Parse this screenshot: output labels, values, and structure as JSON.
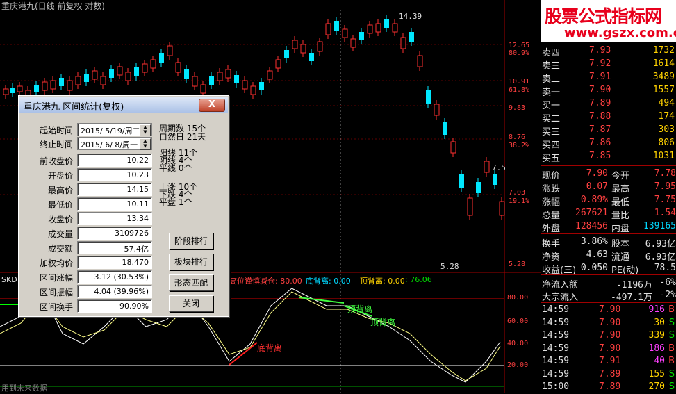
{
  "title": "重庆港九(日线 前复权 对数)",
  "price_labels": {
    "high": "14.39",
    "mid": "7.5",
    "low": "5.28"
  },
  "axis_right": {
    "t1": "12.65",
    "p1": "80.9%",
    "t2": "10.91",
    "p2": "61.8%",
    "t3": "9.83",
    "t4": "8.76",
    "p4": "38.2%",
    "t5": "7.03",
    "p5": "19.1%",
    "t6": "5.28",
    "i1": "80.00",
    "i2": "60.00",
    "i3": "40.00",
    "i4": "20.00"
  },
  "indicator": {
    "name": "SKD",
    "caption": "高位谨慎减仓: 80.00",
    "dbl_label": "底背离: 0.00",
    "tbl_label": "顶背离: 0.00",
    "val": ": 76.06",
    "ann_bottom": "底背离",
    "ann_top1": "顶背离",
    "ann_top2": "顶背离",
    "footer": "用到未来数据"
  },
  "banner": {
    "line1": "股票公式指标网",
    "line2": "www.gszx.com.cn"
  },
  "order_book": [
    {
      "label": "卖四",
      "price": "7.93",
      "vol": "1732"
    },
    {
      "label": "卖三",
      "price": "7.92",
      "vol": "1614"
    },
    {
      "label": "卖二",
      "price": "7.91",
      "vol": "3489"
    },
    {
      "label": "卖一",
      "price": "7.90",
      "vol": "1557"
    },
    {
      "label": "买一",
      "price": "7.89",
      "vol": "494"
    },
    {
      "label": "买二",
      "price": "7.88",
      "vol": "174"
    },
    {
      "label": "买三",
      "price": "7.87",
      "vol": "303"
    },
    {
      "label": "买四",
      "price": "7.86",
      "vol": "806"
    },
    {
      "label": "买五",
      "price": "7.85",
      "vol": "1031"
    }
  ],
  "quote": [
    {
      "l1": "现价",
      "v1": "7.90",
      "l2": "今开",
      "v2": "7.78"
    },
    {
      "l1": "涨跌",
      "v1": "0.07",
      "l2": "最高",
      "v2": "7.95"
    },
    {
      "l1": "涨幅",
      "v1": "0.89%",
      "l2": "最低",
      "v2": "7.75"
    },
    {
      "l1": "总量",
      "v1": "267621",
      "l2": "量比",
      "v2": "1.54"
    },
    {
      "l1": "外盘",
      "v1": "128456",
      "l2": "内盘",
      "v2": "139165"
    },
    {
      "l1": "换手",
      "v1": "3.86%",
      "l2": "股本",
      "v2": "6.93亿"
    },
    {
      "l1": "净资",
      "v1": "4.63",
      "l2": "流通",
      "v2": "6.93亿"
    },
    {
      "l1": "收益(三)",
      "v1": "0.050",
      "l2": "PE(动)",
      "v2": "78.5"
    }
  ],
  "flow": [
    {
      "l": "净流入额",
      "v": "-1196万",
      "p": "-6%"
    },
    {
      "l": "大宗流入",
      "v": "-497.1万",
      "p": "-2%"
    }
  ],
  "ticks": [
    {
      "t": "14:59",
      "p": "7.90",
      "v": "916",
      "s": "B"
    },
    {
      "t": "14:59",
      "p": "7.90",
      "v": "30",
      "s": "S"
    },
    {
      "t": "14:59",
      "p": "7.90",
      "v": "339",
      "s": "S"
    },
    {
      "t": "14:59",
      "p": "7.90",
      "v": "186",
      "s": "B"
    },
    {
      "t": "14:59",
      "p": "7.91",
      "v": "40",
      "s": "B"
    },
    {
      "t": "14:59",
      "p": "7.89",
      "v": "155",
      "s": "S"
    },
    {
      "t": "15:00",
      "p": "7.89",
      "v": "270",
      "s": "S"
    }
  ],
  "dialog": {
    "title": "重庆港九 区间统计(复权)",
    "close": "X",
    "start_label": "起始时间",
    "start_value": "2015/ 5/19/周二",
    "end_label": "终止时间",
    "end_value": "2015/ 6/ 8/周一",
    "rows": [
      {
        "label": "前收盘价",
        "value": "10.22"
      },
      {
        "label": "开盘价",
        "value": "10.23"
      },
      {
        "label": "最高价",
        "value": "14.15"
      },
      {
        "label": "最低价",
        "value": "10.11"
      },
      {
        "label": "收盘价",
        "value": "13.34"
      },
      {
        "label": "成交量",
        "value": "3109726"
      },
      {
        "label": "成交额",
        "value": "57.4亿"
      },
      {
        "label": "加权均价",
        "value": "18.470"
      },
      {
        "label": "区间涨幅",
        "value": "3.12 (30.53%)"
      },
      {
        "label": "区间振幅",
        "value": "4.04 (39.96%)"
      },
      {
        "label": "区间换手",
        "value": "90.90%"
      }
    ],
    "stats": {
      "period": "周期数 15个",
      "natural": "自然日 21天",
      "yang": "阳线 11个",
      "yin": "阴线 4个",
      "flat": "平线 0个",
      "up": "上涨 10个",
      "down": "下跌 4个",
      "even": "平盘 1个"
    },
    "buttons": {
      "b1": "阶段排行",
      "b2": "板块排行",
      "b3": "形态匹配",
      "b4": "关闭"
    }
  }
}
